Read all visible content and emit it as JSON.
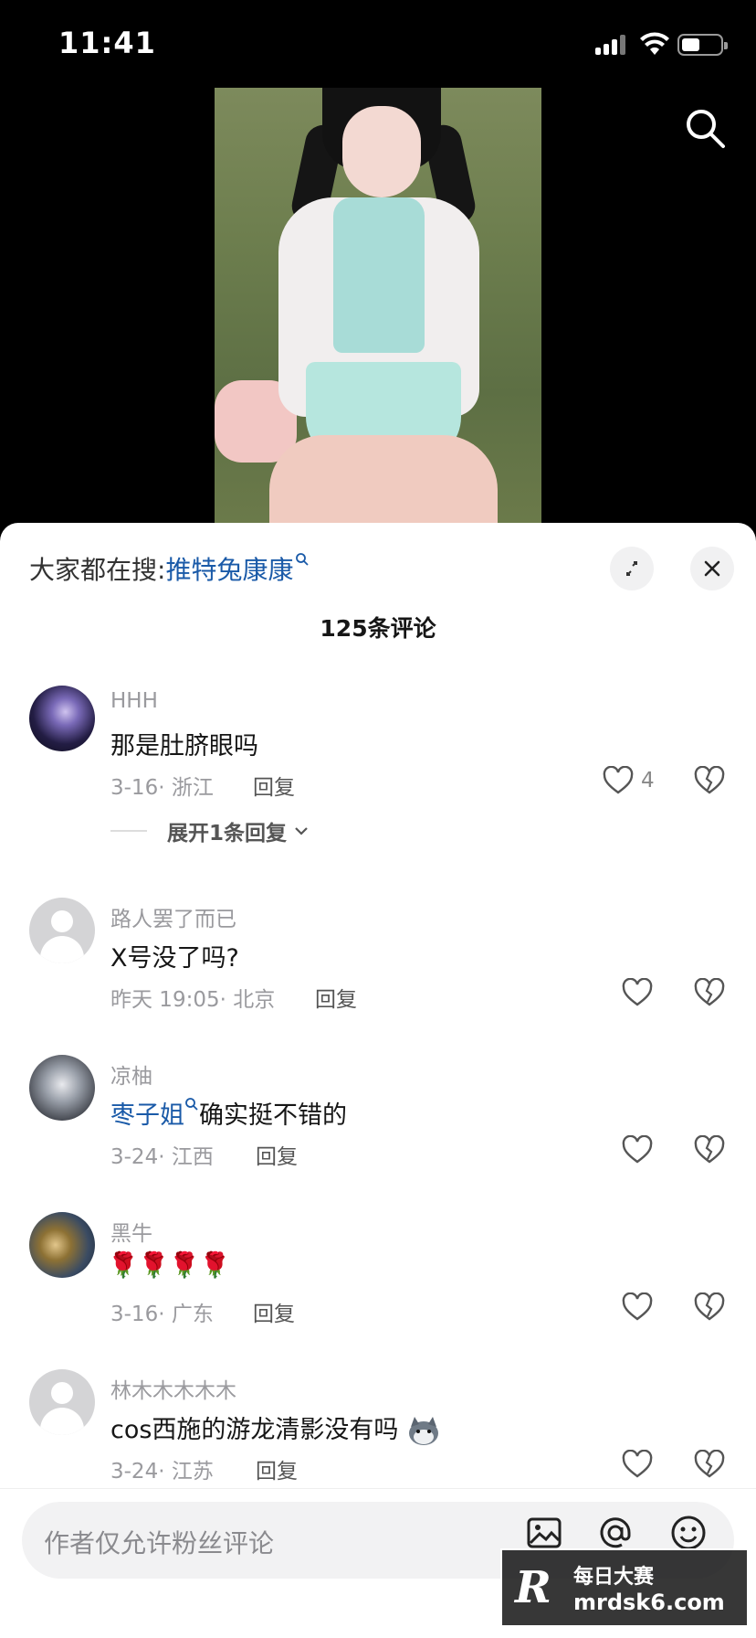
{
  "status_bar": {
    "time": "11:41"
  },
  "sheet": {
    "trending_prefix": "大家都在搜:",
    "trending_keyword": "推特兔康康",
    "comment_count": "125条评论"
  },
  "comments": [
    {
      "user": "HHH",
      "text": "那是肚脐眼吗",
      "meta": "3-16· 浙江",
      "reply": "回复",
      "likes": "4",
      "expand": "展开1条回复"
    },
    {
      "user": "路人罢了而已",
      "text": "X号没了吗?",
      "meta": "昨天 19:05· 北京",
      "reply": "回复"
    },
    {
      "user": "凉柚",
      "mention": "枣子姐",
      "text": "确实挺不错的",
      "meta": "3-24· 江西",
      "reply": "回复"
    },
    {
      "user": "黑牛",
      "text": "🌹🌹🌹🌹",
      "meta": "3-16· 广东",
      "reply": "回复"
    },
    {
      "user": "林木木木木木",
      "text": "cos西施的游龙清影没有吗",
      "meta": "3-24· 江苏",
      "reply": "回复"
    }
  ],
  "input": {
    "placeholder": "作者仅允许粉丝评论"
  },
  "watermark": {
    "logo": "R",
    "title": "每日大赛",
    "url": "mrdsk6.com"
  },
  "colors": {
    "link": "#1a5aa8",
    "muted": "#9a9a9e",
    "sheet_bg": "#ffffff",
    "input_bg": "#f2f2f3"
  }
}
